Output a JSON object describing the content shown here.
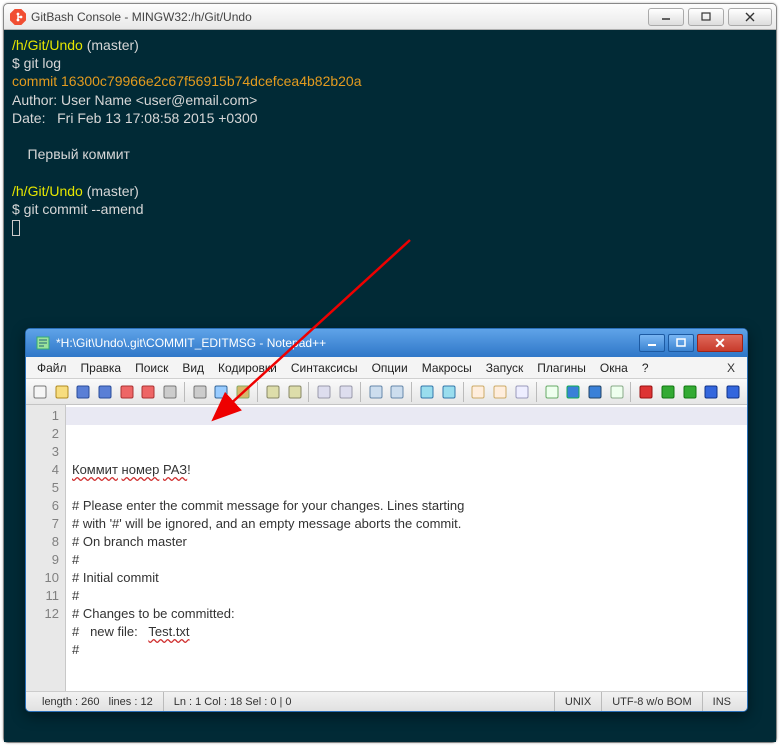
{
  "gitbash": {
    "title": "GitBash Console - MINGW32:/h/Git/Undo",
    "lines": [
      {
        "cls": "t-path",
        "text": "/h/Git/Undo"
      },
      {
        "cls": "t-white",
        "text": "$ git log"
      },
      {
        "cls": "t-gold",
        "text": "commit 16300c79966e2c67f56915b74dcefcea4b82b20a"
      },
      {
        "cls": "t-white",
        "text": "Author: User Name <user@email.com>"
      },
      {
        "cls": "t-white",
        "text": "Date:   Fri Feb 13 17:08:58 2015 +0300"
      },
      {
        "cls": "t-white",
        "text": ""
      },
      {
        "cls": "t-white",
        "text": "    Первый коммит"
      },
      {
        "cls": "t-white",
        "text": ""
      },
      {
        "cls": "t-path",
        "text": "/h/Git/Undo"
      },
      {
        "cls": "t-white",
        "text": "$ git commit --amend"
      }
    ],
    "branch_suffix": " (master)"
  },
  "npp": {
    "title": "*H:\\Git\\Undo\\.git\\COMMIT_EDITMSG - Notepad++",
    "menu": [
      "Файл",
      "Правка",
      "Поиск",
      "Вид",
      "Кодировки",
      "Синтаксисы",
      "Опции",
      "Макросы",
      "Запуск",
      "Плагины",
      "Окна",
      "?"
    ],
    "toolbar_close": "X",
    "editor": {
      "lines": [
        {
          "n": 1,
          "seg": [
            {
              "t": "Коммит",
              "w": true
            },
            {
              "t": " "
            },
            {
              "t": "номер",
              "w": true
            },
            {
              "t": " "
            },
            {
              "t": "РАЗ",
              "w": true
            },
            {
              "t": "!"
            }
          ]
        },
        {
          "n": 2,
          "seg": [
            {
              "t": ""
            }
          ]
        },
        {
          "n": 3,
          "seg": [
            {
              "t": "# Please enter the commit message for your changes. Lines starting"
            }
          ]
        },
        {
          "n": 4,
          "seg": [
            {
              "t": "# with '#' will be ignored, and an empty message aborts the commit."
            }
          ]
        },
        {
          "n": 5,
          "seg": [
            {
              "t": "# On branch master"
            }
          ]
        },
        {
          "n": 6,
          "seg": [
            {
              "t": "#"
            }
          ]
        },
        {
          "n": 7,
          "seg": [
            {
              "t": "# Initial commit"
            }
          ]
        },
        {
          "n": 8,
          "seg": [
            {
              "t": "#"
            }
          ]
        },
        {
          "n": 9,
          "seg": [
            {
              "t": "# Changes to be committed:"
            }
          ]
        },
        {
          "n": 10,
          "seg": [
            {
              "t": "#   new file:   "
            },
            {
              "t": "Test.txt",
              "w": true
            }
          ]
        },
        {
          "n": 11,
          "seg": [
            {
              "t": "#"
            }
          ]
        },
        {
          "n": 12,
          "seg": [
            {
              "t": ""
            }
          ]
        }
      ]
    },
    "status": {
      "length_label": "length : 260",
      "lines_label": "lines : 12",
      "pos": "Ln : 1   Col : 18   Sel : 0 | 0",
      "eol": "UNIX",
      "enc": "UTF-8 w/o BOM",
      "mode": "INS"
    }
  },
  "toolbar_icons": [
    {
      "name": "new-file-icon",
      "c": "#f5f5f5",
      "b": "#777"
    },
    {
      "name": "open-file-icon",
      "c": "#f7dd7f",
      "b": "#b08a20"
    },
    {
      "name": "save-icon",
      "c": "#5a7fd6",
      "b": "#2a4c9a"
    },
    {
      "name": "save-all-icon",
      "c": "#5a7fd6",
      "b": "#2a4c9a"
    },
    {
      "name": "close-file-icon",
      "c": "#e66",
      "b": "#a33"
    },
    {
      "name": "close-all-icon",
      "c": "#e66",
      "b": "#a33"
    },
    {
      "name": "print-icon",
      "c": "#ccc",
      "b": "#777"
    },
    {
      "name": "sep"
    },
    {
      "name": "cut-icon",
      "c": "#ccc",
      "b": "#777"
    },
    {
      "name": "copy-icon",
      "c": "#9cf",
      "b": "#369"
    },
    {
      "name": "paste-icon",
      "c": "#d7b86b",
      "b": "#8a6"
    },
    {
      "name": "sep"
    },
    {
      "name": "undo-icon",
      "c": "#dda",
      "b": "#886"
    },
    {
      "name": "redo-icon",
      "c": "#dda",
      "b": "#886"
    },
    {
      "name": "sep"
    },
    {
      "name": "search-icon",
      "c": "#dde",
      "b": "#99a"
    },
    {
      "name": "replace-icon",
      "c": "#dde",
      "b": "#99a"
    },
    {
      "name": "sep"
    },
    {
      "name": "zoom-in-icon",
      "c": "#cde",
      "b": "#68a"
    },
    {
      "name": "zoom-out-icon",
      "c": "#cde",
      "b": "#68a"
    },
    {
      "name": "sep"
    },
    {
      "name": "sync-v-icon",
      "c": "#9de",
      "b": "#37a"
    },
    {
      "name": "sync-h-icon",
      "c": "#9de",
      "b": "#37a"
    },
    {
      "name": "sep"
    },
    {
      "name": "wrap-icon",
      "c": "#fed",
      "b": "#ca6"
    },
    {
      "name": "show-chars-icon",
      "c": "#fed",
      "b": "#ca6"
    },
    {
      "name": "indent-guide-icon",
      "c": "#eef",
      "b": "#99b"
    },
    {
      "name": "sep"
    },
    {
      "name": "lang-icon",
      "c": "#efe",
      "b": "#6a6"
    },
    {
      "name": "func-list-icon",
      "c": "#3a80d8",
      "b": "#1a5"
    },
    {
      "name": "folder-tree-icon",
      "c": "#3a80d8",
      "b": "#246"
    },
    {
      "name": "doc-map-icon",
      "c": "#efe",
      "b": "#8a8"
    },
    {
      "name": "sep"
    },
    {
      "name": "record-icon",
      "c": "#d33",
      "b": "#911"
    },
    {
      "name": "play-icon",
      "c": "#3a3",
      "b": "#171"
    },
    {
      "name": "play-multi-icon",
      "c": "#3a3",
      "b": "#171"
    },
    {
      "name": "stop-icon",
      "c": "#36d",
      "b": "#138"
    },
    {
      "name": "save-macro-icon",
      "c": "#36d",
      "b": "#138"
    }
  ]
}
